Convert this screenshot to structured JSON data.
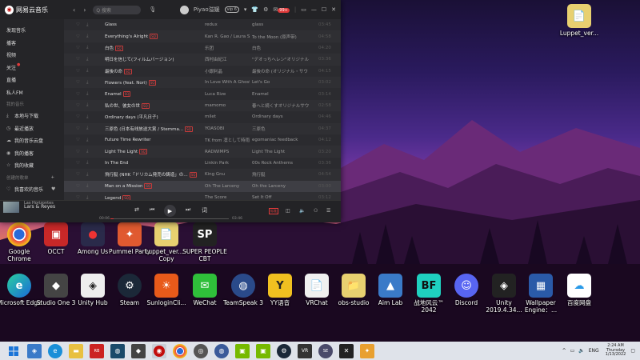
{
  "app": {
    "title": "网易云音乐",
    "search_placeholder": "Q 搜索",
    "username": "Piyao溢媛",
    "vip_badge": "vip 6",
    "notif_badge": "99+",
    "accent": "#c20c0c"
  },
  "sidebar": {
    "items": [
      {
        "label": "发现音乐",
        "icon": ""
      },
      {
        "label": "播客",
        "icon": ""
      },
      {
        "label": "视频",
        "icon": ""
      },
      {
        "label": "关注",
        "icon": ""
      },
      {
        "label": "直播",
        "icon": ""
      },
      {
        "label": "私人FM",
        "icon": ""
      }
    ],
    "my_music_header": "我的音乐",
    "my_music": [
      {
        "label": "本地与下载",
        "icon": "download-icon"
      },
      {
        "label": "最近播放",
        "icon": "clock-icon"
      },
      {
        "label": "我的音乐云盘",
        "icon": "cloud-icon"
      },
      {
        "label": "我的播客",
        "icon": "podcast-icon"
      },
      {
        "label": "我的收藏",
        "icon": "star-icon"
      }
    ],
    "created_header": "创建的歌单",
    "playlists": [
      {
        "label": "我喜欢的音乐",
        "icon": "heart-icon"
      }
    ]
  },
  "songs": [
    {
      "title": "Glass",
      "tag": "",
      "artist": "redux",
      "album": "glass",
      "dur": "03:45"
    },
    {
      "title": "Everything's Alright",
      "tag": "SQ",
      "artist": "Kan R. Gao / Laura Shigihara",
      "album": "To the Moon (原声带)",
      "dur": "04:58"
    },
    {
      "title": "白色",
      "tag": "SQ",
      "artist": "乐团",
      "album": "白色",
      "dur": "04:20"
    },
    {
      "title": "明日を信じて(フィルムバージョン)",
      "tag": "",
      "artist": "西村由紀江",
      "album": "\"デオっちへレン\"オリジナル",
      "dur": "03:36"
    },
    {
      "title": "最後の命",
      "tag": "SQ",
      "artist": "小銀利晶",
      "album": "最後の命 (オリジナル・サウ",
      "dur": "04:15"
    },
    {
      "title": "Flowers (feat. Nori)",
      "tag": "SQ",
      "artist": "In Love With A Ghost",
      "album": "Let's Go",
      "dur": "03:02"
    },
    {
      "title": "Enamel",
      "tag": "SQ",
      "artist": "Luca Rize",
      "album": "Enamel",
      "dur": "03:14"
    },
    {
      "title": "私の世、彼女の世",
      "tag": "SQ",
      "artist": "mamomo",
      "album": "春へと続くすオリジナルサウ",
      "dur": "02:58"
    },
    {
      "title": "Ordinary days (平凡日子)",
      "tag": "",
      "artist": "milet",
      "album": "Ordinary days",
      "dur": "04:46"
    },
    {
      "title": "三原色 (日本有线放送大賞 / Stemma...",
      "tag": "SQ",
      "artist": "YOASOBI",
      "album": "三原色",
      "dur": "04:37"
    },
    {
      "title": "Future Time Rewriter",
      "tag": "",
      "artist": "TK from 凛として時雨",
      "album": "egomaniac feedback",
      "dur": "04:12"
    },
    {
      "title": "Light The Light",
      "tag": "SQ",
      "artist": "RADWIMPS",
      "album": "Light The Light",
      "dur": "03:20"
    },
    {
      "title": "In The End",
      "tag": "",
      "artist": "Linkin Park",
      "album": "00s Rock Anthems",
      "dur": "03:36"
    },
    {
      "title": "飛行艇 (NHK「ドリカム発売の鋳造」の…",
      "tag": "SQ",
      "artist": "King Gnu",
      "album": "飛行艇",
      "dur": "04:54"
    },
    {
      "title": "Man on a Mission",
      "tag": "SQ",
      "artist": "Oh The Larceny",
      "album": "Oh the Larceny",
      "dur": "03:00"
    },
    {
      "title": "Legend",
      "tag": "SQ",
      "artist": "The Score",
      "album": "Set It Off",
      "dur": "03:12"
    }
  ],
  "player": {
    "track": "Las Horizontes",
    "artist": "Lars & Reyes",
    "time_current": "00:06",
    "time_total": "03:46",
    "progress": 0.03,
    "quality": "标准"
  },
  "desktop_icons": [
    {
      "label": "Luppet_ver...",
      "color": "#e8d070",
      "glyph": "📄"
    },
    {
      "label": "Google Chrome",
      "color": "#2a6ad8",
      "glyph": "◉"
    },
    {
      "label": "OCCT",
      "color": "#c82828",
      "glyph": "▣"
    },
    {
      "label": "Among Us",
      "color": "#c22",
      "glyph": "●"
    },
    {
      "label": "Pummel Party",
      "color": "#e05a30",
      "glyph": "✦"
    },
    {
      "label": "Luppet_ver... - Copy",
      "color": "#e8d070",
      "glyph": "📄"
    },
    {
      "label": "SUPER PEOPLE CBT",
      "color": "#222",
      "glyph": "SP"
    },
    {
      "label": "Microsoft Edge",
      "color": "#1a8fd8",
      "glyph": "e"
    },
    {
      "label": "Studio One 3",
      "color": "#444",
      "glyph": "◆"
    },
    {
      "label": "Unity Hub",
      "color": "#eee",
      "glyph": "◈"
    },
    {
      "label": "Steam",
      "color": "#1b2838",
      "glyph": "⚙"
    },
    {
      "label": "SunloginCli...",
      "color": "#e85a1a",
      "glyph": "☀"
    },
    {
      "label": "WeChat",
      "color": "#2fbf3a",
      "glyph": "✉"
    },
    {
      "label": "TeamSpeak 3",
      "color": "#2a4a8a",
      "glyph": "◍"
    },
    {
      "label": "YY语音",
      "color": "#f0c020",
      "glyph": "Y"
    },
    {
      "label": "VRChat",
      "color": "#f0f0f0",
      "glyph": "📄"
    },
    {
      "label": "obs-studio",
      "color": "#e8d070",
      "glyph": "📁"
    },
    {
      "label": "Aim Lab",
      "color": "#3a7ac8",
      "glyph": "▲"
    },
    {
      "label": "战地风云™ 2042",
      "color": "#1fd0c0",
      "glyph": "BF"
    },
    {
      "label": "Discord",
      "color": "#5865f2",
      "glyph": "☺"
    },
    {
      "label": "Unity 2019.4.34...",
      "color": "#222",
      "glyph": "◈"
    },
    {
      "label": "Wallpaper Engine：...",
      "color": "#2a5aa8",
      "glyph": "▦"
    },
    {
      "label": "百度网盘",
      "color": "#2a9ae8",
      "glyph": "☁"
    }
  ],
  "taskbar": {
    "clock_time": "2:24 AM",
    "clock_day": "Thursday",
    "clock_date": "1/13/2022",
    "lang": "ENG"
  }
}
